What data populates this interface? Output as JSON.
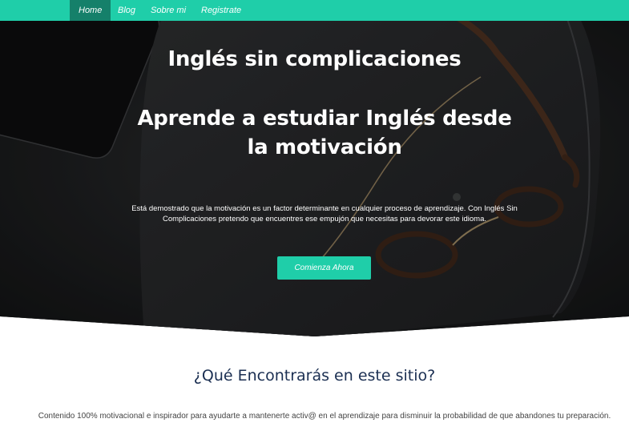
{
  "nav": {
    "items": [
      {
        "label": "Home"
      },
      {
        "label": "Blog"
      },
      {
        "label": "Sobre mi"
      },
      {
        "label": "Registrate"
      }
    ],
    "active": "Home"
  },
  "hero": {
    "title": "Inglés sin complicaciones",
    "subtitle": "Aprende a estudiar Inglés desde la motivación",
    "text": "Está demostrado que la motivación es un factor determinante en cualquier proceso de aprendizaje. Con Inglés Sin Complicaciones pretendo que encuentres ese empujón que necesitas para devorar este idioma.",
    "cta_label": "Comienza Ahora"
  },
  "section": {
    "title": "¿Qué Encontrarás en este sitio?",
    "text": "Contenido 100% motivacional e inspirador para ayudarte a mantenerte activ@ en el aprendizaje para disminuir la probabilidad de que abandones tu preparación."
  },
  "colors": {
    "accent": "#1fcea9",
    "nav_active": "#15806a",
    "heading_dark": "#1b2f52"
  }
}
